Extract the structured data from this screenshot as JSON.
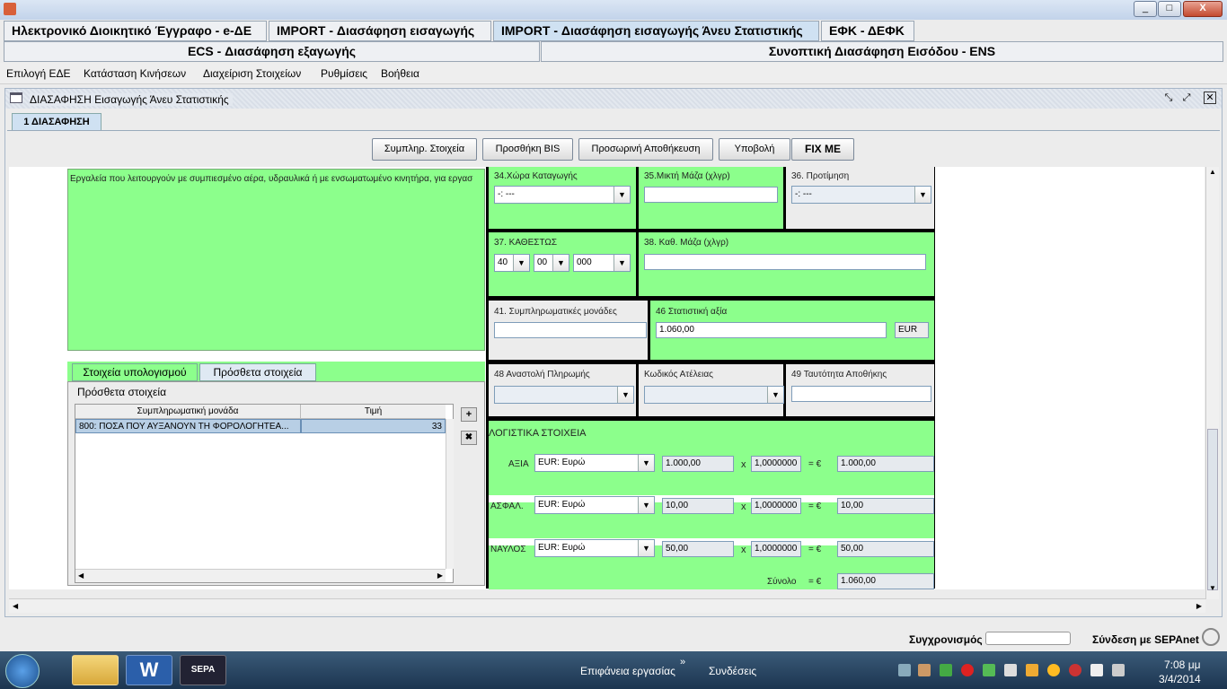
{
  "window": {
    "minimize": "_",
    "maximize": "□",
    "close": "X"
  },
  "tabs_row1": [
    "Ηλεκτρονικό Διοικητικό Έγγραφο - e-ΔΕ",
    "IMPORT - Διασάφηση εισαγωγής",
    "IMPORT - Διασάφηση εισαγωγής Άνευ Στατιστικής",
    "ΕΦΚ - ΔΕΦΚ"
  ],
  "tabs_row2": [
    "ECS - Διασάφηση εξαγωγής",
    "Συνοπτική Διασάφηση Εισόδου - ENS"
  ],
  "menu": [
    "Επιλογή ΕΔΕ",
    "Κατάσταση Κινήσεων",
    "Διαχείριση Στοιχείων",
    "Ρυθμίσεις",
    "Βοήθεια"
  ],
  "internal_frame": {
    "title": "ΔΙΑΣΑΦΗΣΗ Εισαγωγής Άνευ Στατιστικής",
    "subtab": "1 ΔΙΑΣΑΦΗΣΗ"
  },
  "toolbar": [
    "Συμπληρ. Στοιχεία",
    "Προσθήκη BIS",
    "Προσωρινή Αποθήκευση",
    "Υποβολή",
    "FIX ME"
  ],
  "description_text": "Εργαλεία που λειτουργούν με συμπιεσμένο αέρα, υδραυλικά ή με ενσωματωμένο κινητήρα, για εργασ",
  "lower_tabs": [
    "Στοιχεία υπολογισμού",
    "Πρόσθετα στοιχεία"
  ],
  "additional": {
    "title": "Πρόσθετα στοιχεία",
    "col1": "Συμπληρωματική μονάδα",
    "col2": "Τιμή",
    "row_unit": "800: ΠΟΣΑ ΠΟΥ ΑΥΞΑΝΟΥΝ ΤΗ ΦΟΡΟΛΟΓΗΤΕΑ...",
    "row_value": "33"
  },
  "fields": {
    "f34_label": "34.Χώρα Καταγωγής",
    "f34_value": "-: ---",
    "f35_label": "35.Μικτή Μάζα (χλγρ)",
    "f35_value": "",
    "f36_label": "36. Προτίμηση",
    "f36_value": "-: ---",
    "f37_label": "37. ΚΑΘΕΣΤΩΣ",
    "f37_a": "40",
    "f37_b": "00",
    "f37_c": "000",
    "f38_label": "38. Καθ. Μάζα (χλγρ)",
    "f38_value": "",
    "f41_label": "41. Συμπληρωματικές μονάδες",
    "f41_value": "",
    "f46_label": "46 Στατιστική αξία",
    "f46_value": "1.060,00",
    "f46_currency": "EUR",
    "f48_label": "48 Αναστολή Πληρωμής",
    "f48_value": "",
    "fexempt_label": "Κωδικός Ατέλειας",
    "fexempt_value": "",
    "f49_label": "49 Ταυτότητα Αποθήκης",
    "f49_value": ""
  },
  "accounting": {
    "title": "ΛΟΓΙΣΤΙΚΑ ΣΤΟΙΧΕΙΑ",
    "rows": [
      {
        "label": "ΑΞΙΑ",
        "currency": "EUR: Ευρώ",
        "amount": "1.000,00",
        "x": "x",
        "rate": "1,0000000",
        "eq": "= €",
        "result": "1.000,00"
      },
      {
        "label": "ΑΣΦΑΛ.",
        "currency": "EUR: Ευρώ",
        "amount": "10,00",
        "x": "x",
        "rate": "1,0000000",
        "eq": "= €",
        "result": "10,00"
      },
      {
        "label": "ΝΑΥΛΟΣ",
        "currency": "EUR: Ευρώ",
        "amount": "50,00",
        "x": "x",
        "rate": "1,0000000",
        "eq": "= €",
        "result": "50,00"
      }
    ],
    "total_label": "Σύνολο",
    "total_eq": "= €",
    "total": "1.060,00"
  },
  "status": {
    "sync": "Συγχρονισμός",
    "sepa": "Σύνδεση με SEPAnet"
  },
  "taskbar": {
    "desktop": "Επιφάνεια εργασίας",
    "links": "Συνδέσεις",
    "time": "7:08 μμ",
    "date": "3/4/2014",
    "word_icon": "W",
    "sepa_icon": "SEPA",
    "expand": "»"
  }
}
